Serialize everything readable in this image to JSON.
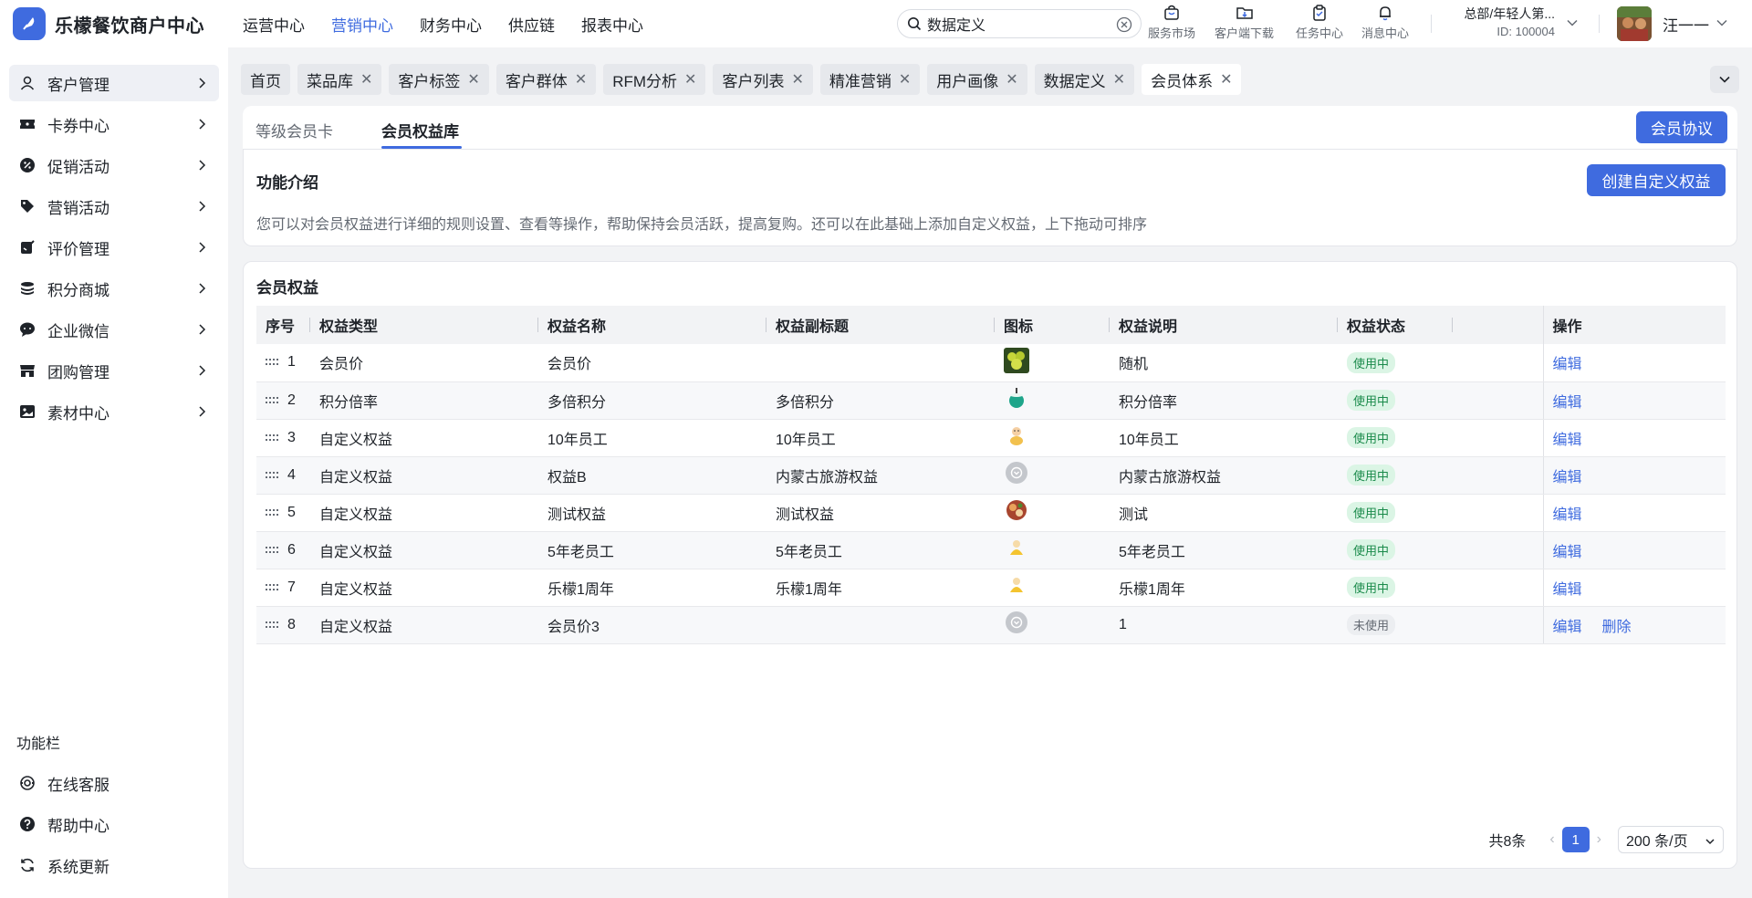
{
  "brand": {
    "name": "乐檬餐饮商户中心",
    "logo_icon": "lemon-leaf-icon"
  },
  "top_nav": [
    {
      "label": "运营中心",
      "active": false
    },
    {
      "label": "营销中心",
      "active": true
    },
    {
      "label": "财务中心",
      "active": false
    },
    {
      "label": "供应链",
      "active": false
    },
    {
      "label": "报表中心",
      "active": false
    }
  ],
  "search": {
    "value": "数据定义",
    "placeholder": ""
  },
  "tools": [
    {
      "label": "服务市场",
      "icon": "shop-bag-icon"
    },
    {
      "label": "客户端下载",
      "icon": "folder-download-icon"
    },
    {
      "label": "任务中心",
      "icon": "clipboard-icon"
    },
    {
      "label": "消息中心",
      "icon": "bell-icon"
    }
  ],
  "org": {
    "name": "总部/年轻人第...",
    "id": "ID: 100004"
  },
  "user": {
    "name": "汪一一"
  },
  "sidebar": {
    "items": [
      {
        "label": "客户管理",
        "icon": "user-icon",
        "active": true
      },
      {
        "label": "卡券中心",
        "icon": "ticket-icon",
        "active": false
      },
      {
        "label": "促销活动",
        "icon": "discount-badge-icon",
        "active": false
      },
      {
        "label": "营销活动",
        "icon": "tag-icon",
        "active": false
      },
      {
        "label": "评价管理",
        "icon": "edit-note-icon",
        "active": false
      },
      {
        "label": "积分商城",
        "icon": "coins-icon",
        "active": false
      },
      {
        "label": "企业微信",
        "icon": "chat-bubble-icon",
        "active": false
      },
      {
        "label": "团购管理",
        "icon": "store-icon",
        "active": false
      },
      {
        "label": "素材中心",
        "icon": "image-icon",
        "active": false
      }
    ],
    "section_title": "功能栏",
    "footer_items": [
      {
        "label": "在线客服",
        "icon": "headset-icon"
      },
      {
        "label": "帮助中心",
        "icon": "help-circle-icon"
      },
      {
        "label": "系统更新",
        "icon": "refresh-icon"
      }
    ]
  },
  "page_tabs": [
    {
      "label": "首页",
      "closable": false
    },
    {
      "label": "菜品库",
      "closable": true
    },
    {
      "label": "客户标签",
      "closable": true
    },
    {
      "label": "客户群体",
      "closable": true
    },
    {
      "label": "RFM分析",
      "closable": true
    },
    {
      "label": "客户列表",
      "closable": true
    },
    {
      "label": "精准营销",
      "closable": true
    },
    {
      "label": "用户画像",
      "closable": true
    },
    {
      "label": "数据定义",
      "closable": true
    },
    {
      "label": "会员体系",
      "closable": true,
      "active": true
    }
  ],
  "sub_tabs": [
    {
      "label": "等级会员卡",
      "active": false
    },
    {
      "label": "会员权益库",
      "active": true
    }
  ],
  "buttons": {
    "member_agreement": "会员协议",
    "create_custom": "创建自定义权益"
  },
  "intro": {
    "title": "功能介绍",
    "description": "您可以对会员权益进行详细的规则设置、查看等操作，帮助保持会员活跃，提高复购。还可以在此基础上添加自定义权益，上下拖动可排序"
  },
  "benefits": {
    "title": "会员权益",
    "columns": [
      "序号",
      "权益类型",
      "权益名称",
      "权益副标题",
      "图标",
      "权益说明",
      "权益状态",
      "",
      "操作"
    ],
    "rows": [
      {
        "seq": "1",
        "type": "会员价",
        "name": "会员价",
        "subtitle": "",
        "icon": "fruit-plate-icon",
        "desc": "随机",
        "status": "使用中",
        "active": true,
        "actions": [
          "编辑"
        ]
      },
      {
        "seq": "2",
        "type": "积分倍率",
        "name": "多倍积分",
        "subtitle": "多倍积分",
        "icon": "coconut-drink-icon",
        "desc": "积分倍率",
        "status": "使用中",
        "active": true,
        "actions": [
          "编辑"
        ]
      },
      {
        "seq": "3",
        "type": "自定义权益",
        "name": "10年员工",
        "subtitle": "10年员工",
        "icon": "cartoon-figure-icon",
        "desc": "10年员工",
        "status": "使用中",
        "active": true,
        "actions": [
          "编辑"
        ]
      },
      {
        "seq": "4",
        "type": "自定义权益",
        "name": "权益B",
        "subtitle": "内蒙古旅游权益",
        "icon": "default-circle-icon",
        "desc": "内蒙古旅游权益",
        "status": "使用中",
        "active": true,
        "actions": [
          "编辑"
        ]
      },
      {
        "seq": "5",
        "type": "自定义权益",
        "name": "测试权益",
        "subtitle": "测试权益",
        "icon": "meat-dish-icon",
        "desc": "测试",
        "status": "使用中",
        "active": true,
        "actions": [
          "编辑"
        ]
      },
      {
        "seq": "6",
        "type": "自定义权益",
        "name": "5年老员工",
        "subtitle": "5年老员工",
        "icon": "yellow-figure-icon",
        "desc": "5年老员工",
        "status": "使用中",
        "active": true,
        "actions": [
          "编辑"
        ]
      },
      {
        "seq": "7",
        "type": "自定义权益",
        "name": "乐檬1周年",
        "subtitle": "乐檬1周年",
        "icon": "yellow-figure-icon",
        "desc": "乐檬1周年",
        "status": "使用中",
        "active": true,
        "actions": [
          "编辑"
        ]
      },
      {
        "seq": "8",
        "type": "自定义权益",
        "name": "会员价3",
        "subtitle": "",
        "icon": "default-circle-icon",
        "desc": "1",
        "status": "未使用",
        "active": false,
        "actions": [
          "编辑",
          "删除"
        ]
      }
    ]
  },
  "pagination": {
    "total": "共8条",
    "current": "1",
    "page_size": "200 条/页"
  },
  "colors": {
    "primary": "#3f6bdf",
    "status_active_bg": "#dbf5e5",
    "status_active_text": "#1a8a4a",
    "status_inactive_bg": "#eceef1"
  }
}
